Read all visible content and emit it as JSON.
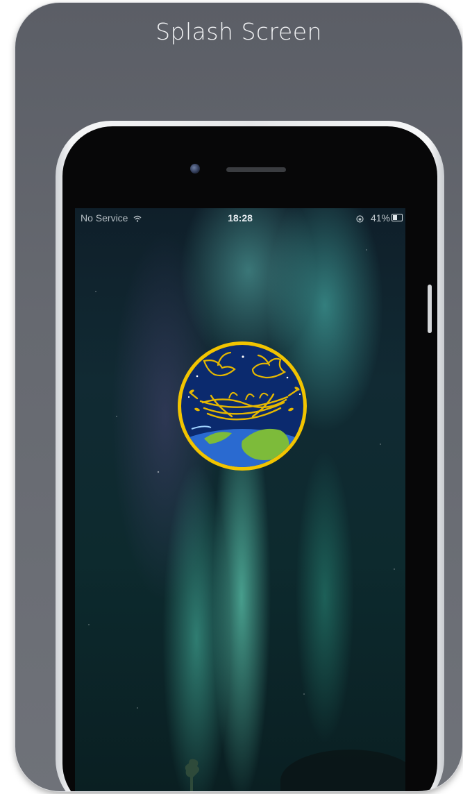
{
  "page": {
    "title": "Splash Screen"
  },
  "statusbar": {
    "carrier": "No Service",
    "time": "18:28",
    "battery": "41%"
  },
  "colors": {
    "card_background": "#666970",
    "logo_border": "#f2c400",
    "logo_background": "#0b2a6e",
    "logo_gold": "#e6b800",
    "earth_blue": "#2a6ad0",
    "earth_green": "#7dbb3a"
  },
  "icons": {
    "wifi": "wifi-icon",
    "orientation_lock": "orientation-lock-icon",
    "battery": "battery-icon",
    "app_logo": "birds-nest-earth-logo"
  }
}
